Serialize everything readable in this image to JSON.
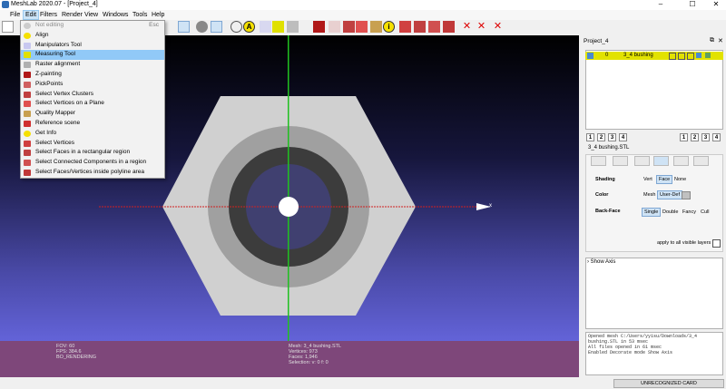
{
  "window": {
    "title": "MeshLab 2020.07 - [Project_4]",
    "controls": {
      "minimize": "–",
      "maximize": "☐",
      "close": "✕"
    }
  },
  "menubar": {
    "items": [
      "File",
      "Edit",
      "Filters",
      "Render",
      "View",
      "Windows",
      "Tools",
      "Help"
    ],
    "active": "Edit"
  },
  "edit_menu": {
    "items": [
      {
        "label": "Not editing",
        "shortcut": "Esc",
        "disabled": true
      },
      {
        "label": "Align"
      },
      {
        "label": "Manipulators Tool"
      },
      {
        "label": "Measuring Tool",
        "highlighted": true
      },
      {
        "label": "Raster alignment"
      },
      {
        "label": "Z-painting"
      },
      {
        "label": "PickPoints"
      },
      {
        "label": "Select Vertex Clusters"
      },
      {
        "label": "Select Vertices on a Plane"
      },
      {
        "label": "Quality Mapper"
      },
      {
        "label": "Reference scene"
      },
      {
        "label": "Get Info"
      },
      {
        "label": "Select Vertices"
      },
      {
        "label": "Select Faces in a rectangular region"
      },
      {
        "label": "Select Connected Components in a region"
      },
      {
        "label": "Select Faces/Vertices inside polyline area"
      }
    ]
  },
  "viewport": {
    "info_left": [
      "FOV: 60",
      "FPS:  384.6",
      "BO_RENDERING"
    ],
    "info_right": [
      "Mesh: 3_4 bushing.STL",
      "Vertices: 973",
      "Faces: 1,946",
      "Selection: v: 0 f: 0"
    ],
    "axis_label": "x"
  },
  "layer_panel": {
    "title": "Project_4",
    "layer": {
      "index": "0",
      "name": "3_4 bushing"
    },
    "raster_buttons_left": [
      "1",
      "2",
      "3",
      "4"
    ],
    "raster_buttons_right": [
      "1",
      "2",
      "3",
      "4"
    ],
    "selected_mesh": "3_4 bushing.STL"
  },
  "render_options": {
    "shading": {
      "label": "Shading",
      "options": [
        "Vert",
        "Face",
        "None"
      ],
      "selected": "Face"
    },
    "color": {
      "label": "Color",
      "options": [
        "Mesh",
        "User-Def"
      ],
      "selected": "User-Def"
    },
    "backface": {
      "label": "Back-Face",
      "options": [
        "Single",
        "Double",
        "Fancy",
        "Cull"
      ],
      "selected": "Single"
    },
    "apply_all": "apply to all visible layers"
  },
  "decorators": {
    "show_axis": "Show Axis"
  },
  "log": {
    "lines": [
      "Opened mesh C:/Users/yyisu/Downloads/3_4",
      "bushing.STL in 53 msec",
      "All files opened in 61 msec",
      "Enabled Decorate mode Show Axis"
    ]
  },
  "statusbar": {
    "card_button": "UNRECOGNIZED CARD"
  },
  "colors": {
    "infobar": "#7e477a",
    "layer_highlight": "#e2e200",
    "menu_highlight": "#91c9f7",
    "axis_x": "#d02020",
    "axis_y": "#20c020"
  }
}
